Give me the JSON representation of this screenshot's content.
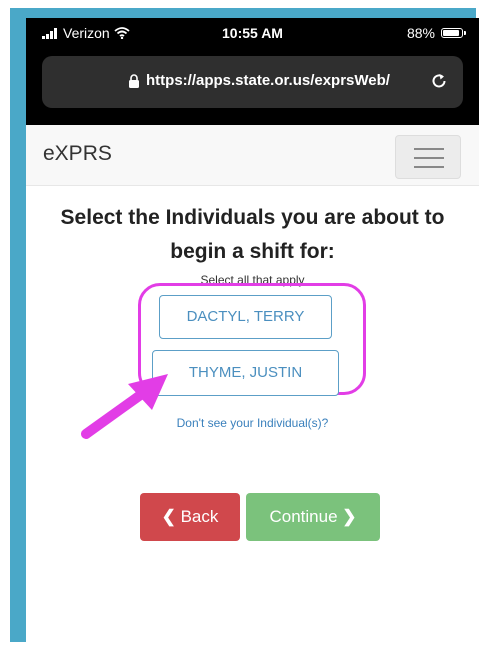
{
  "status_bar": {
    "carrier": "Verizon",
    "time": "10:55 AM",
    "battery": "88%"
  },
  "url_bar": {
    "url": "https://apps.state.or.us/exprsWeb/"
  },
  "navbar": {
    "brand": "eXPRS"
  },
  "main": {
    "heading": "Select the Individuals you are about to begin a shift for:",
    "subtext": "Select all that apply",
    "individuals": [
      {
        "name": "DACTYL, TERRY"
      },
      {
        "name": "THYME, JUSTIN"
      }
    ],
    "help_link": "Don't see your Individual(s)?",
    "back_label": "Back",
    "continue_label": "Continue"
  },
  "colors": {
    "frame": "#4aa8c8",
    "highlight": "#e23de6",
    "back": "#d0484c",
    "continue": "#7bc27c",
    "link": "#3a80bc"
  },
  "icons": [
    "signal-icon",
    "wifi-icon",
    "battery-icon",
    "lock-icon",
    "reload-icon",
    "hamburger-icon",
    "chevron-left-icon",
    "chevron-right-icon"
  ]
}
